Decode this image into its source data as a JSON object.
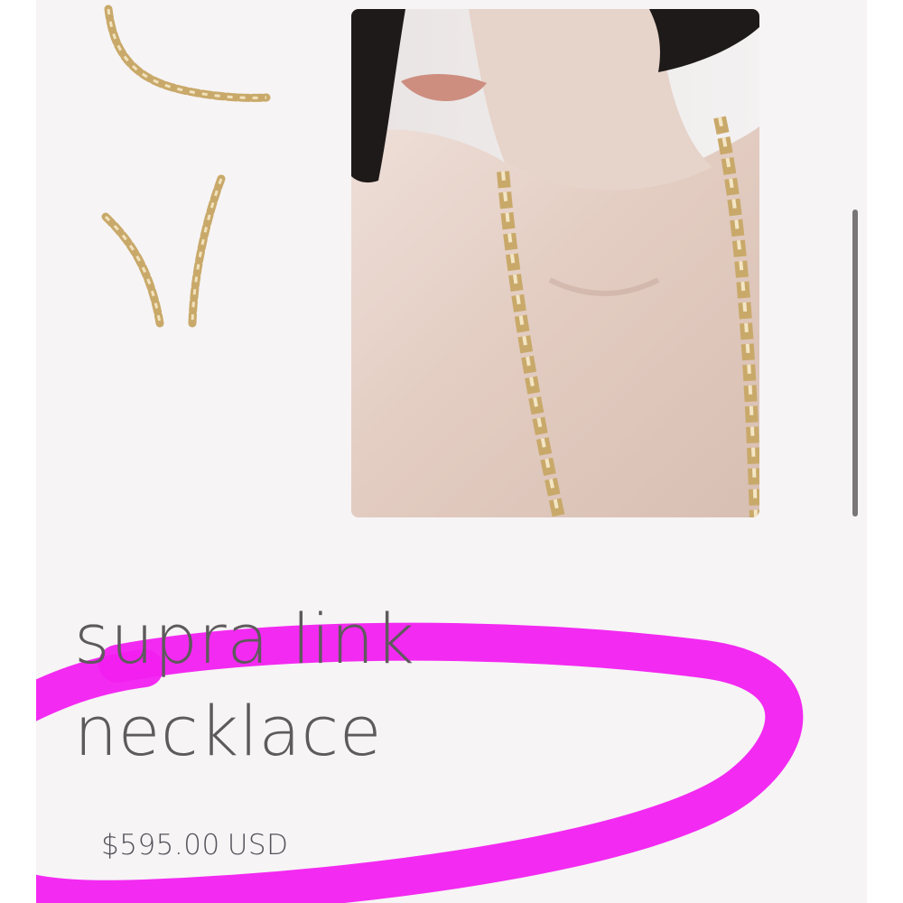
{
  "product": {
    "title_line1": "supra link",
    "title_line2": "necklace",
    "price_amount": "$595.00",
    "price_currency": "USD"
  },
  "gallery": {
    "thumbnails": [
      {
        "name": "thumb-necklace-drape",
        "icon": "gold-chain-image"
      },
      {
        "name": "thumb-necklace-pair",
        "icon": "gold-chain-image"
      }
    ],
    "main_image": {
      "icon": "model-wearing-chain-image"
    }
  },
  "colors": {
    "background": "#f6f4f5",
    "title": "#5e5a5c",
    "marker": "#f21ff0",
    "gold": "#c9a96a"
  }
}
